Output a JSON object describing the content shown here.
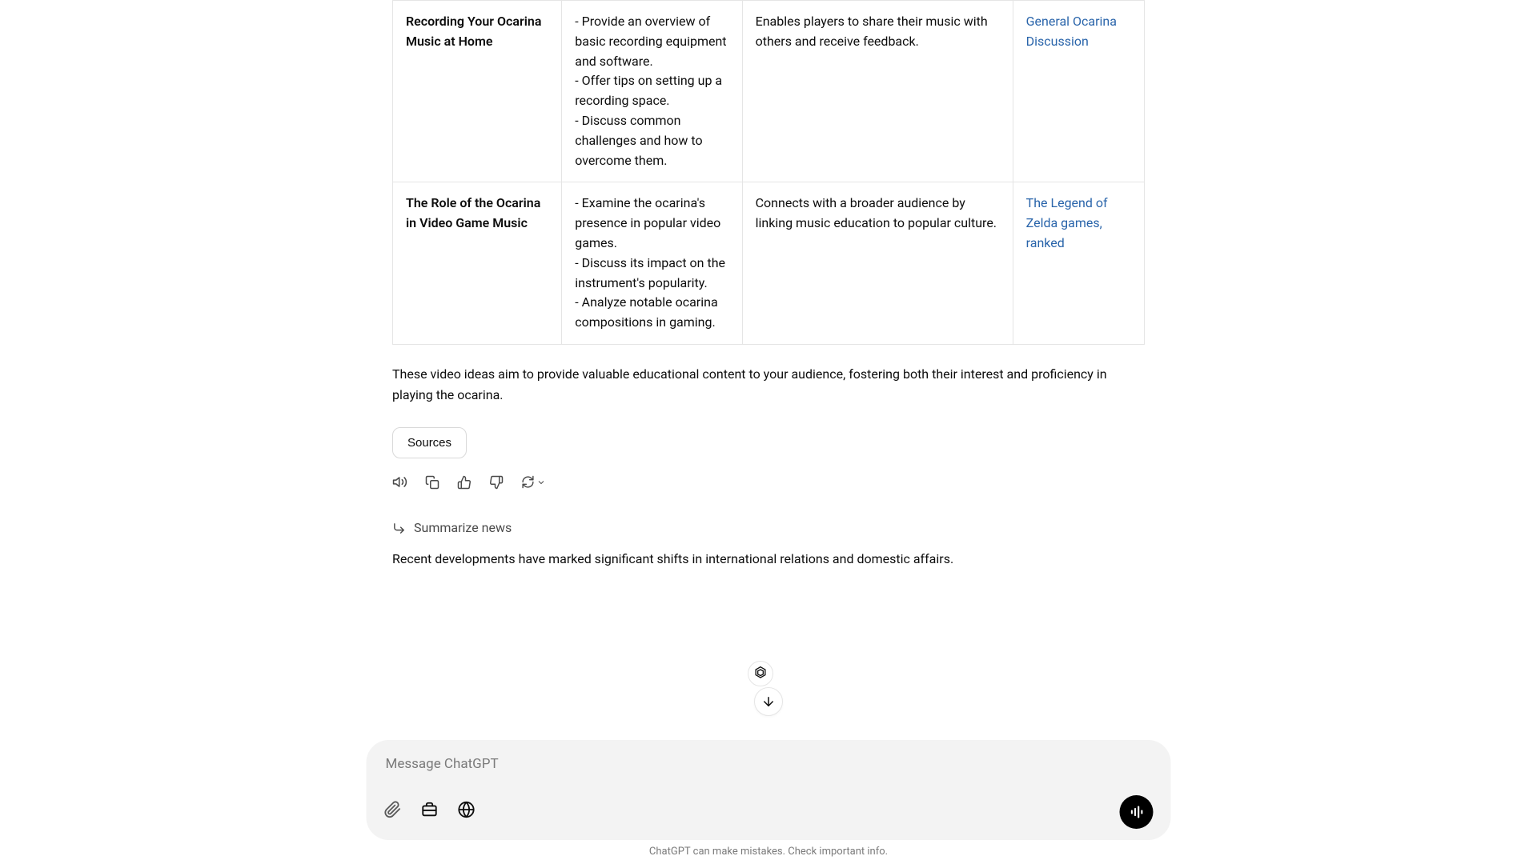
{
  "table": {
    "rows": [
      {
        "title": "Recording Your Ocarina Music at Home",
        "desc": "- Provide an overview of basic recording equipment and software.\n- Offer tips on setting up a recording space.\n- Discuss common challenges and how to overcome them.",
        "benefit": "Enables players to share their music with others and receive feedback.",
        "link_text": "General Ocarina Discussion"
      },
      {
        "title": "The Role of the Ocarina in Video Game Music",
        "desc": "- Examine the ocarina's presence in popular video games.\n- Discuss its impact on the instrument's popularity.\n- Analyze notable ocarina compositions in gaming.",
        "benefit": "Connects with a broader audience by linking music education to popular culture.",
        "link_text": "The Legend of Zelda games, ranked"
      }
    ]
  },
  "closing": "These video ideas aim to provide valuable educational content to your audience, fostering both their interest and proficiency in playing the ocarina.",
  "sources_label": "Sources",
  "next_prompt": "Summarize news",
  "next_text": "Recent developments have marked significant shifts in international relations and domestic affairs.",
  "input_placeholder": "Message ChatGPT",
  "footer_note": "ChatGPT can make mistakes. Check important info."
}
